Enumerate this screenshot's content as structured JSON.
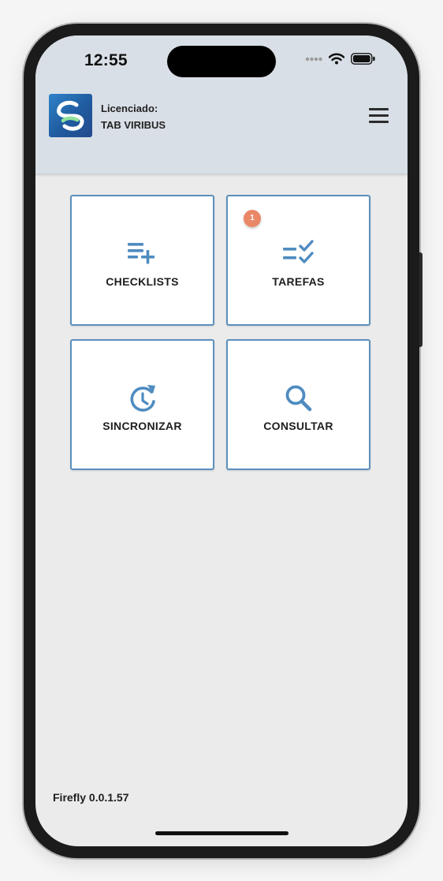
{
  "status_bar": {
    "time": "12:55"
  },
  "header": {
    "licensee_label": "Licenciado:",
    "licensee_name": "TAB VIRIBUS",
    "menu_icon": "hamburger-menu-icon"
  },
  "tiles": [
    {
      "label": "CHECKLISTS",
      "icon": "playlist-add-icon"
    },
    {
      "label": "TAREFAS",
      "icon": "checklist-icon",
      "badge": "1"
    },
    {
      "label": "SINCRONIZAR",
      "icon": "sync-history-icon"
    },
    {
      "label": "CONSULTAR",
      "icon": "search-icon"
    }
  ],
  "footer": {
    "version": "Firefly 0.0.1.57"
  },
  "colors": {
    "accent": "#4f8cc0",
    "header_bg": "#d9dfe6",
    "badge": "#ea8767",
    "tile_border": "#5a90bd"
  }
}
